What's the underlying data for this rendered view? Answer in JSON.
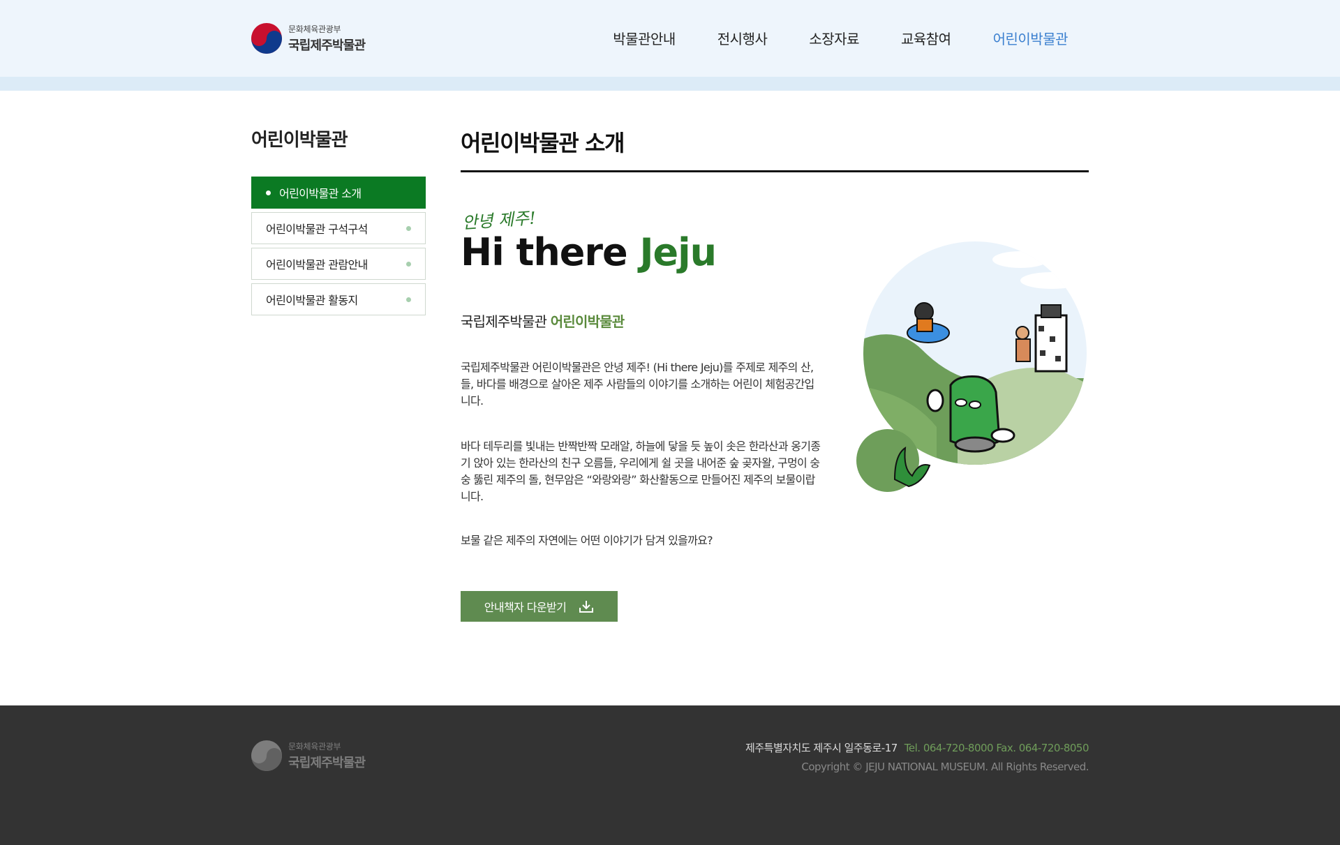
{
  "header": {
    "logo_sub": "문화체육관광부",
    "logo_main": "국립제주박물관",
    "nav": [
      "박물관안내",
      "전시행사",
      "소장자료",
      "교육참여",
      "어린이박물관"
    ],
    "active_nav": "어린이박물관"
  },
  "sidebar": {
    "title": "어린이박물관",
    "items": [
      {
        "label": "어린이박물관 소개",
        "active": true
      },
      {
        "label": "어린이박물관 구석구석",
        "active": false
      },
      {
        "label": "어린이박물관 관람안내",
        "active": false
      },
      {
        "label": "어린이박물관 활동지",
        "active": false
      }
    ]
  },
  "main": {
    "page_title": "어린이박물관 소개",
    "hello_kr": "안녕 제주!",
    "hero_black": "Hi there ",
    "hero_green": "Jeju",
    "subtitle_black": "국립제주박물관 ",
    "subtitle_green": "어린이박물관",
    "para1": "국립제주박물관 어린이박물관은 안녕 제주! (Hi there Jeju)를 주제로 제주의 산, 들, 바다를 배경으로 살아온 제주 사람들의 이야기를 소개하는 어린이 체험공간입니다.",
    "para2": "바다 테두리를 빛내는 반짝반짝 모래알, 하늘에 닿을 듯 높이 솟은 한라산과 옹기종기 앉아 있는 한라산의 친구 오름들, 우리에게 쉴 곳을 내어준 숲 곶자왈, 구멍이 숭숭 뚫린 제주의 돌, 현무암은 “와랑와랑” 화산활동으로 만들어진 제주의 보물이랍니다.",
    "para3": "보물 같은 제주의 자연에는 어떤 이야기가 담겨 있을까요?",
    "download_label": "안내책자 다운받기"
  },
  "footer": {
    "logo_sub": "문화체육관광부",
    "logo_main": "국립제주박물관",
    "address": "제주특별자치도 제주시 일주동로-17",
    "tel": "Tel. 064-720-8000   Fax. 064-720-8050",
    "copyright": "Copyright © JEJU NATIONAL MUSEUM. All Rights Reserved."
  },
  "colors": {
    "green_dark": "#0b7a23",
    "green_button": "#5f8b50",
    "nav_active": "#3a7fcf",
    "footer_bg": "#333333"
  }
}
